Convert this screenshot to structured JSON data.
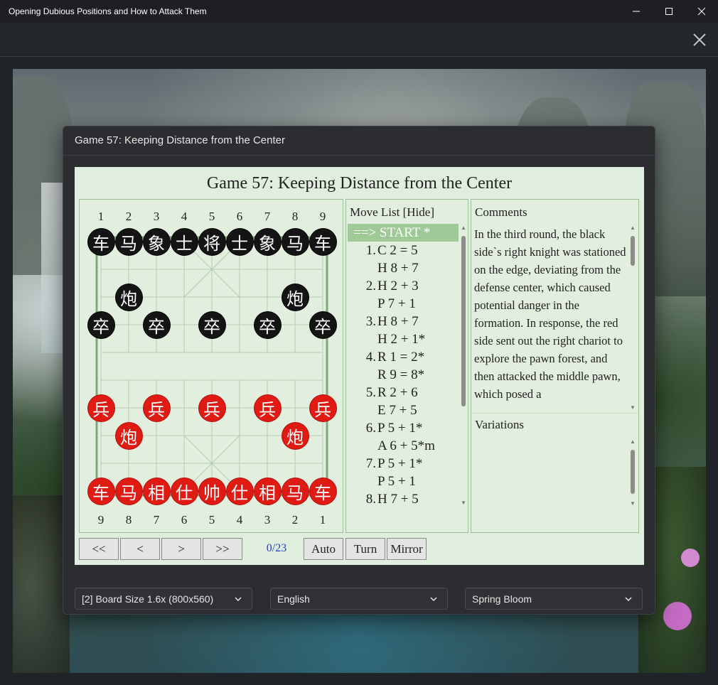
{
  "window": {
    "title": "Opening Dubious Positions and How to Attack Them"
  },
  "dialog": {
    "title": "Game 57: Keeping Distance from the Center"
  },
  "game": {
    "title": "Game 57: Keeping Distance from the Center"
  },
  "board": {
    "top_numbers": [
      "1",
      "2",
      "3",
      "4",
      "5",
      "6",
      "7",
      "8",
      "9"
    ],
    "bottom_numbers": [
      "9",
      "8",
      "7",
      "6",
      "5",
      "4",
      "3",
      "2",
      "1"
    ],
    "black_pieces": [
      {
        "char": "车",
        "file": 0,
        "rank": 0
      },
      {
        "char": "马",
        "file": 1,
        "rank": 0
      },
      {
        "char": "象",
        "file": 2,
        "rank": 0
      },
      {
        "char": "士",
        "file": 3,
        "rank": 0
      },
      {
        "char": "将",
        "file": 4,
        "rank": 0
      },
      {
        "char": "士",
        "file": 5,
        "rank": 0
      },
      {
        "char": "象",
        "file": 6,
        "rank": 0
      },
      {
        "char": "马",
        "file": 7,
        "rank": 0
      },
      {
        "char": "车",
        "file": 8,
        "rank": 0
      },
      {
        "char": "炮",
        "file": 1,
        "rank": 2
      },
      {
        "char": "炮",
        "file": 7,
        "rank": 2
      },
      {
        "char": "卒",
        "file": 0,
        "rank": 3
      },
      {
        "char": "卒",
        "file": 2,
        "rank": 3
      },
      {
        "char": "卒",
        "file": 4,
        "rank": 3
      },
      {
        "char": "卒",
        "file": 6,
        "rank": 3
      },
      {
        "char": "卒",
        "file": 8,
        "rank": 3
      }
    ],
    "red_pieces": [
      {
        "char": "兵",
        "file": 0,
        "rank": 6
      },
      {
        "char": "兵",
        "file": 2,
        "rank": 6
      },
      {
        "char": "兵",
        "file": 4,
        "rank": 6
      },
      {
        "char": "兵",
        "file": 6,
        "rank": 6
      },
      {
        "char": "兵",
        "file": 8,
        "rank": 6
      },
      {
        "char": "炮",
        "file": 1,
        "rank": 7
      },
      {
        "char": "炮",
        "file": 7,
        "rank": 7
      },
      {
        "char": "车",
        "file": 0,
        "rank": 9
      },
      {
        "char": "马",
        "file": 1,
        "rank": 9
      },
      {
        "char": "相",
        "file": 2,
        "rank": 9
      },
      {
        "char": "仕",
        "file": 3,
        "rank": 9
      },
      {
        "char": "帅",
        "file": 4,
        "rank": 9
      },
      {
        "char": "仕",
        "file": 5,
        "rank": 9
      },
      {
        "char": "相",
        "file": 6,
        "rank": 9
      },
      {
        "char": "马",
        "file": 7,
        "rank": 9
      },
      {
        "char": "车",
        "file": 8,
        "rank": 9
      }
    ]
  },
  "move_list": {
    "header": "Move List [Hide]",
    "start": "==> START *",
    "moves": [
      {
        "num": "1.",
        "text": "C 2 = 5"
      },
      {
        "num": "",
        "text": "H 8 + 7"
      },
      {
        "num": "2.",
        "text": "H 2 + 3"
      },
      {
        "num": "",
        "text": "P 7 + 1"
      },
      {
        "num": "3.",
        "text": "H 8 + 7"
      },
      {
        "num": "",
        "text": "H 2 + 1*"
      },
      {
        "num": "4.",
        "text": "R 1 = 2*"
      },
      {
        "num": "",
        "text": "R 9 = 8*"
      },
      {
        "num": "5.",
        "text": "R 2 + 6"
      },
      {
        "num": "",
        "text": "E 7 + 5"
      },
      {
        "num": "6.",
        "text": "P 5 + 1*"
      },
      {
        "num": "",
        "text": "A 6 + 5*m"
      },
      {
        "num": "7.",
        "text": "P 5 + 1*"
      },
      {
        "num": "",
        "text": "P 5 + 1"
      },
      {
        "num": "8.",
        "text": "H 7 + 5"
      }
    ]
  },
  "comments": {
    "header": "Comments",
    "text": "In the third round, the black side`s right knight was stationed on the edge, deviating from the defense center, which caused potential danger in the formation. In response, the red side sent out the right chariot to explore the pawn forest, and then attacked the middle pawn, which posed a"
  },
  "variations": {
    "header": "Variations"
  },
  "controls": {
    "first": "<<",
    "prev": "<",
    "next": ">",
    "last": ">>",
    "counter": "0/23",
    "auto": "Auto",
    "turn": "Turn",
    "mirror": "Mirror"
  },
  "footer": {
    "board_size": "[2] Board Size 1.6x (800x560)",
    "language": "English",
    "theme": "Spring Bloom"
  }
}
